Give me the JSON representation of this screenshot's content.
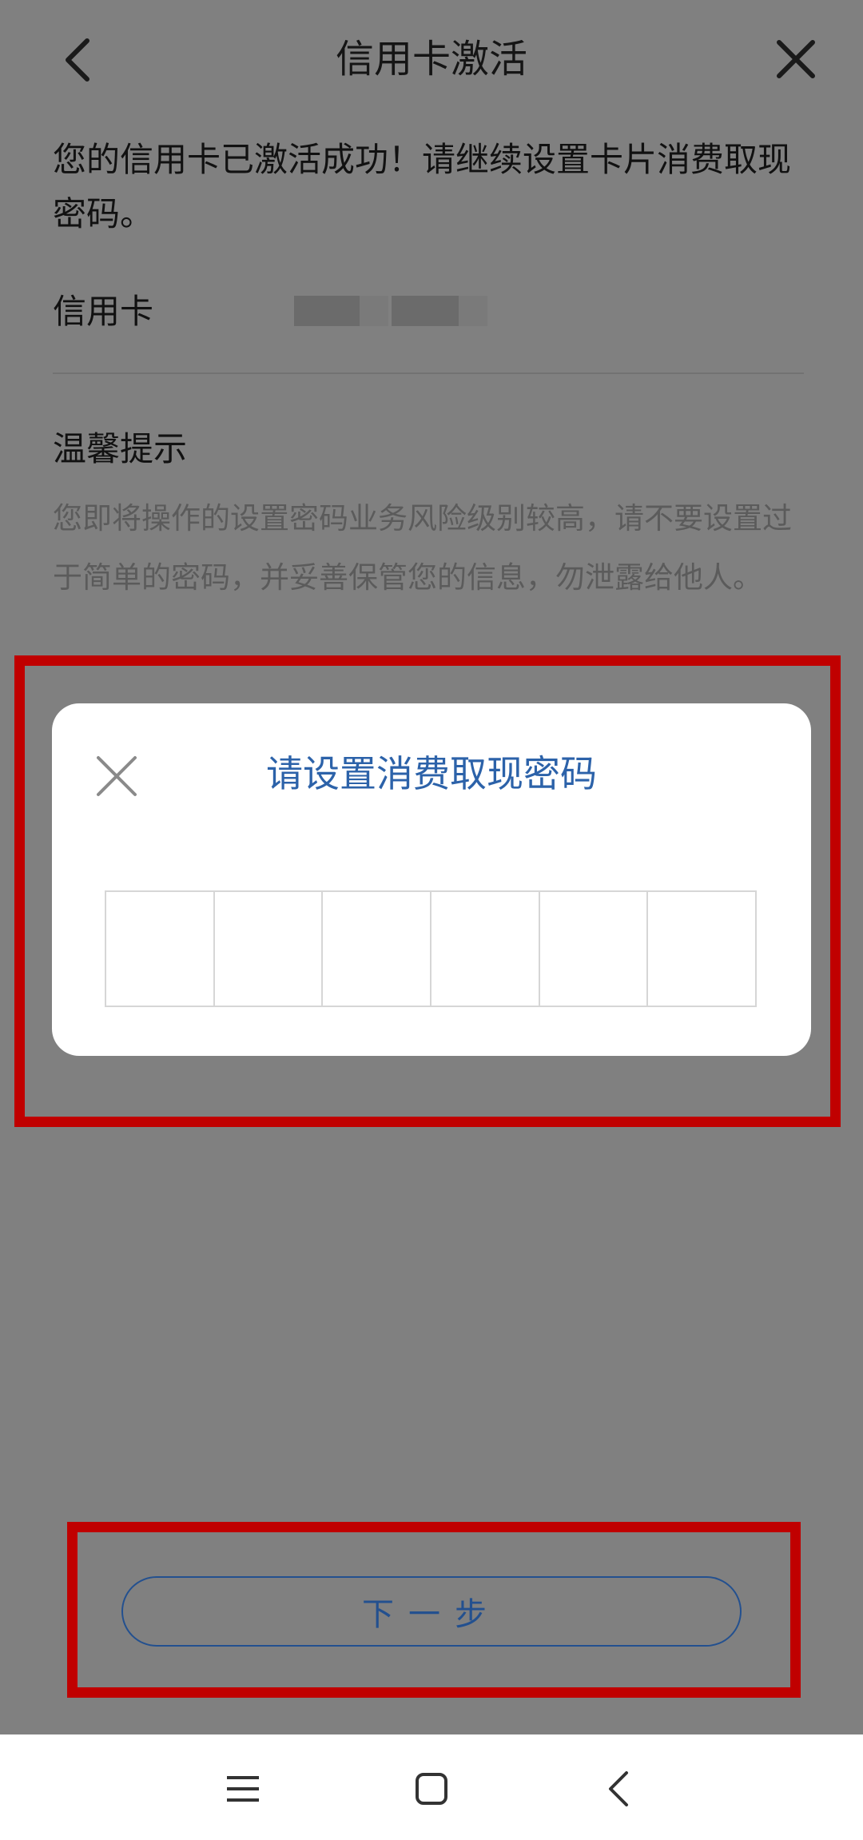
{
  "header": {
    "title": "信用卡激活",
    "back_icon": "chevron-left-icon",
    "close_icon": "close-icon"
  },
  "message": "您的信用卡已激活成功！请继续设置卡片消费取现密码。",
  "card": {
    "label": "信用卡"
  },
  "tips": {
    "title": "温馨提示",
    "body": "您即将操作的设置密码业务风险级别较高，请不要设置过于简单的密码，并妥善保管您的信息，勿泄露给他人。"
  },
  "dialog": {
    "title": "请设置消费取现密码",
    "close_icon": "close-icon",
    "pin_cells": [
      "",
      "",
      "",
      "",
      "",
      ""
    ]
  },
  "next_button": {
    "label": "下一步"
  },
  "colors": {
    "overlay": "#808080",
    "accent": "#2c62a9",
    "annotation": "#c00000"
  },
  "navbar": {
    "icons": [
      "menu-icon",
      "home-icon",
      "back-icon"
    ]
  }
}
